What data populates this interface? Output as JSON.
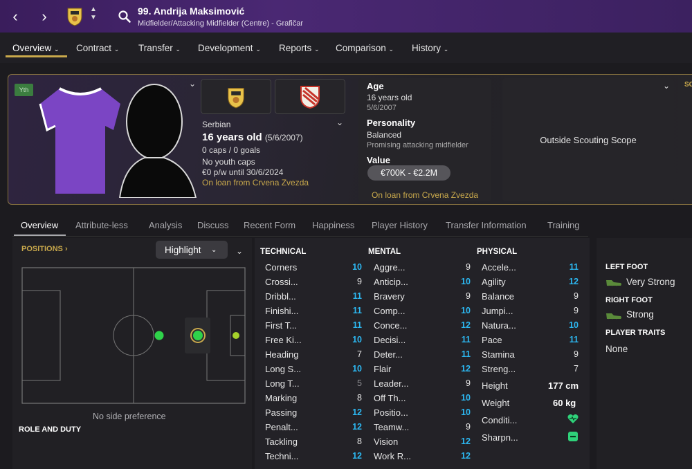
{
  "header": {
    "player_name": "99. Andrija Maksimović",
    "subtitle": "Midfielder/Attacking Midfielder (Centre) - Grafičar"
  },
  "menu": [
    "Overview",
    "Contract",
    "Transfer",
    "Development",
    "Reports",
    "Comparison",
    "History"
  ],
  "profile": {
    "badge": "Yth",
    "nationality": "Serbian",
    "age_line": "16 years old",
    "dob_paren": "(5/6/2007)",
    "caps": "0 caps / 0 goals",
    "youth_caps": "No youth caps",
    "wage": "€0 p/w until 30/6/2024",
    "loan": "On loan from Crvena Zvezda"
  },
  "age_panel": {
    "age_title": "Age",
    "age_value": "16 years old",
    "dob": "5/6/2007",
    "personality_title": "Personality",
    "personality_value": "Balanced",
    "personality_desc": "Promising attacking midfielder",
    "value_title": "Value",
    "value_range": "€700K - €2.2M",
    "loan": "On loan from Crvena Zvezda"
  },
  "scouting": {
    "text": "Outside Scouting Scope",
    "side_label": "SC"
  },
  "tabs": [
    "Overview",
    "Attribute-less",
    "Analysis",
    "Discuss",
    "Recent Form",
    "Happiness",
    "Player History",
    "Transfer Information",
    "Training"
  ],
  "positions": {
    "label": "POSITIONS",
    "highlight": "Highlight",
    "no_side": "No side preference",
    "role_duty": "ROLE AND DUTY"
  },
  "attributes": {
    "technical_title": "TECHNICAL",
    "mental_title": "MENTAL",
    "physical_title": "PHYSICAL",
    "technical": [
      {
        "name": "Corners",
        "value": "10"
      },
      {
        "name": "Crossi...",
        "value": "9"
      },
      {
        "name": "Dribbl...",
        "value": "11"
      },
      {
        "name": "Finishi...",
        "value": "11"
      },
      {
        "name": "First T...",
        "value": "11"
      },
      {
        "name": "Free Ki...",
        "value": "10"
      },
      {
        "name": "Heading",
        "value": "7"
      },
      {
        "name": "Long S...",
        "value": "10"
      },
      {
        "name": "Long T...",
        "value": "5"
      },
      {
        "name": "Marking",
        "value": "8"
      },
      {
        "name": "Passing",
        "value": "12"
      },
      {
        "name": "Penalt...",
        "value": "12"
      },
      {
        "name": "Tackling",
        "value": "8"
      },
      {
        "name": "Techni...",
        "value": "12"
      }
    ],
    "mental": [
      {
        "name": "Aggre...",
        "value": "9"
      },
      {
        "name": "Anticip...",
        "value": "10"
      },
      {
        "name": "Bravery",
        "value": "9"
      },
      {
        "name": "Comp...",
        "value": "10"
      },
      {
        "name": "Conce...",
        "value": "12"
      },
      {
        "name": "Decisi...",
        "value": "11"
      },
      {
        "name": "Deter...",
        "value": "11"
      },
      {
        "name": "Flair",
        "value": "12"
      },
      {
        "name": "Leader...",
        "value": "9"
      },
      {
        "name": "Off Th...",
        "value": "10"
      },
      {
        "name": "Positio...",
        "value": "10"
      },
      {
        "name": "Teamw...",
        "value": "9"
      },
      {
        "name": "Vision",
        "value": "12"
      },
      {
        "name": "Work R...",
        "value": "12"
      }
    ],
    "physical": [
      {
        "name": "Accele...",
        "value": "11"
      },
      {
        "name": "Agility",
        "value": "12"
      },
      {
        "name": "Balance",
        "value": "9"
      },
      {
        "name": "Jumpi...",
        "value": "9"
      },
      {
        "name": "Natura...",
        "value": "10"
      },
      {
        "name": "Pace",
        "value": "11"
      },
      {
        "name": "Stamina",
        "value": "9"
      },
      {
        "name": "Streng...",
        "value": "7"
      }
    ],
    "height_label": "Height",
    "height": "177 cm",
    "weight_label": "Weight",
    "weight": "60 kg",
    "condition_label": "Conditi...",
    "sharpness_label": "Sharpn..."
  },
  "feet": {
    "left_title": "LEFT FOOT",
    "left_value": "Very Strong",
    "right_title": "RIGHT FOOT",
    "right_value": "Strong",
    "traits_title": "PLAYER TRAITS",
    "traits_value": "None"
  },
  "colors": {
    "accent_gold": "#c9a94c",
    "high_attr": "#2cb7f0",
    "header_purple": "#4a2873"
  }
}
